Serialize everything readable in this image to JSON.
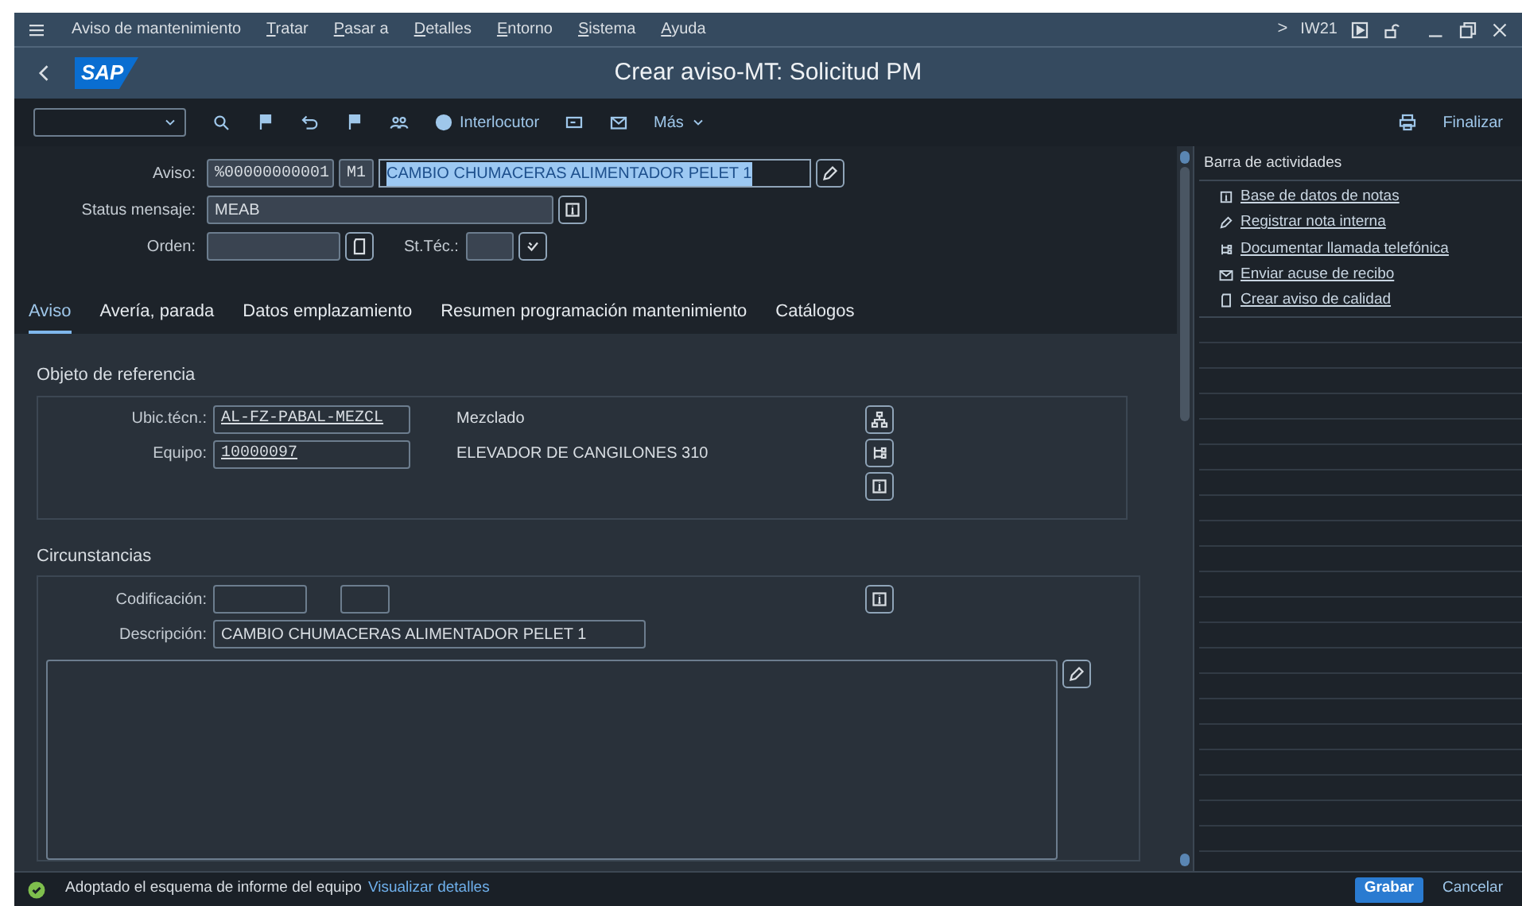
{
  "menu_bar": {
    "items": [
      {
        "label": "Aviso de mantenimiento",
        "mnemonic": false
      },
      {
        "label": "Tratar",
        "mnemonic": true
      },
      {
        "label": "Pasar a",
        "mnemonic": true
      },
      {
        "label": "Detalles",
        "mnemonic": true
      },
      {
        "label": "Entorno",
        "mnemonic": true
      },
      {
        "label": "Sistema",
        "mnemonic": true
      },
      {
        "label": "Ayuda",
        "mnemonic": true
      }
    ],
    "expand": ">",
    "transaction": "IW21"
  },
  "title_bar": {
    "logo": "SAP",
    "title": "Crear aviso-MT: Solicitud PM"
  },
  "toolbar": {
    "partner_button": "Interlocutor",
    "more_button": "Más",
    "exit_button": "Finalizar"
  },
  "header": {
    "notice_label": "Aviso:",
    "notice_number": "%00000000001",
    "notice_type": "M1",
    "notice_text": "CAMBIO CHUMACERAS ALIMENTADOR PELET 1",
    "notice_text_selected": true,
    "status_label": "Status mensaje:",
    "status_value": "MEAB",
    "order_label": "Orden:",
    "tech_status_label": "St.Téc.:"
  },
  "tabs": [
    {
      "label": "Aviso",
      "selected": true
    },
    {
      "label": "Avería, parada",
      "selected": false
    },
    {
      "label": "Datos emplazamiento",
      "selected": false
    },
    {
      "label": "Resumen programación mantenimiento",
      "selected": false
    },
    {
      "label": "Catálogos",
      "selected": false
    }
  ],
  "reference_object": {
    "title": "Objeto de referencia",
    "rows": [
      {
        "label": "Ubic.técn.:",
        "value": "AL-FZ-PABAL-MEZCL",
        "description": "Mezclado"
      },
      {
        "label": "Equipo:",
        "value": "10000097",
        "description": "ELEVADOR DE CANGILONES 310"
      }
    ]
  },
  "circumstances": {
    "title": "Circunstancias",
    "coding_label": "Codificación:",
    "description_label": "Descripción:",
    "description_value": "CAMBIO CHUMACERAS ALIMENTADOR PELET 1"
  },
  "activities": {
    "title": "Barra de actividades",
    "items": [
      "Base de datos de notas",
      "Registrar nota interna",
      "Documentar llamada telefónica",
      "Enviar acuse de recibo",
      "Crear aviso de calidad"
    ]
  },
  "status_bar": {
    "message": "Adoptado el esquema de informe del equipo",
    "details_link": "Visualizar detalles",
    "buttons": [
      {
        "label": "Grabar",
        "kind": "primary"
      },
      {
        "label": "Cancelar",
        "kind": "plain"
      }
    ]
  }
}
